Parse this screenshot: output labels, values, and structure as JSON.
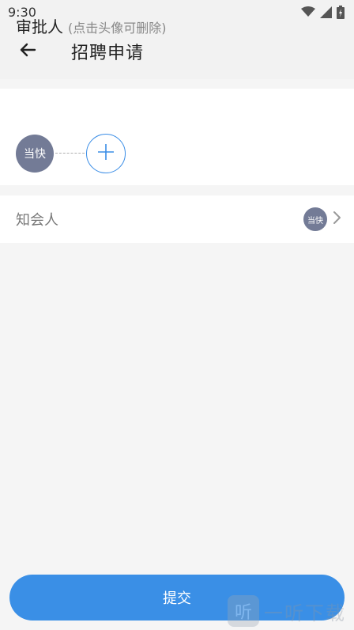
{
  "status_bar": {
    "time": "9:30",
    "icons": [
      "wifi-icon",
      "signal-icon",
      "battery-icon"
    ]
  },
  "app_bar": {
    "back_icon": "arrow-left-icon",
    "title": "招聘申请"
  },
  "approver": {
    "title": "审批人",
    "hint": "(点击头像可删除)",
    "avatar_text": "当快",
    "add_icon": "plus-icon"
  },
  "cc": {
    "label": "知会人",
    "avatar_text": "当快",
    "chevron_icon": "chevron-right-icon"
  },
  "submit": {
    "label": "提交"
  },
  "watermark": {
    "logo_text": "听",
    "text": "一听下载"
  },
  "colors": {
    "accent": "#3a8fe6",
    "avatar": "#737b96",
    "background": "#f5f5f5",
    "bar": "#f2f2f2"
  }
}
